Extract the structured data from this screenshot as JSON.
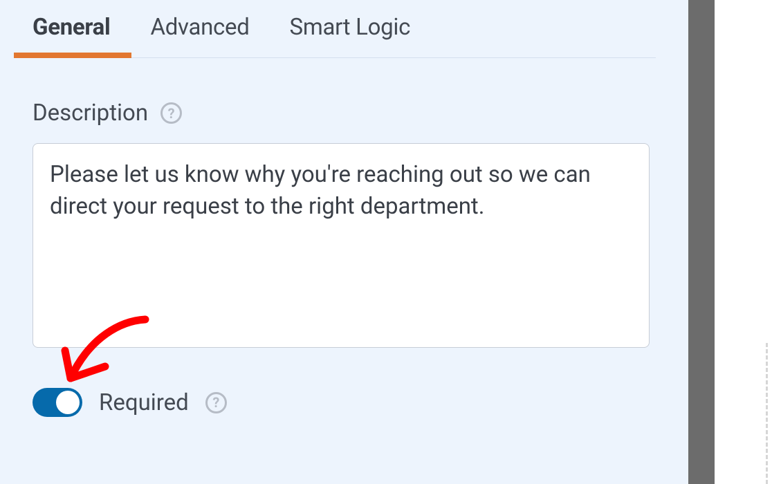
{
  "tabs": [
    {
      "label": "General",
      "active": true
    },
    {
      "label": "Advanced",
      "active": false
    },
    {
      "label": "Smart Logic",
      "active": false
    }
  ],
  "description": {
    "label": "Description",
    "value": "Please let us know why you're reaching out so we can direct your request to the right department."
  },
  "required": {
    "label": "Required",
    "state": true
  }
}
